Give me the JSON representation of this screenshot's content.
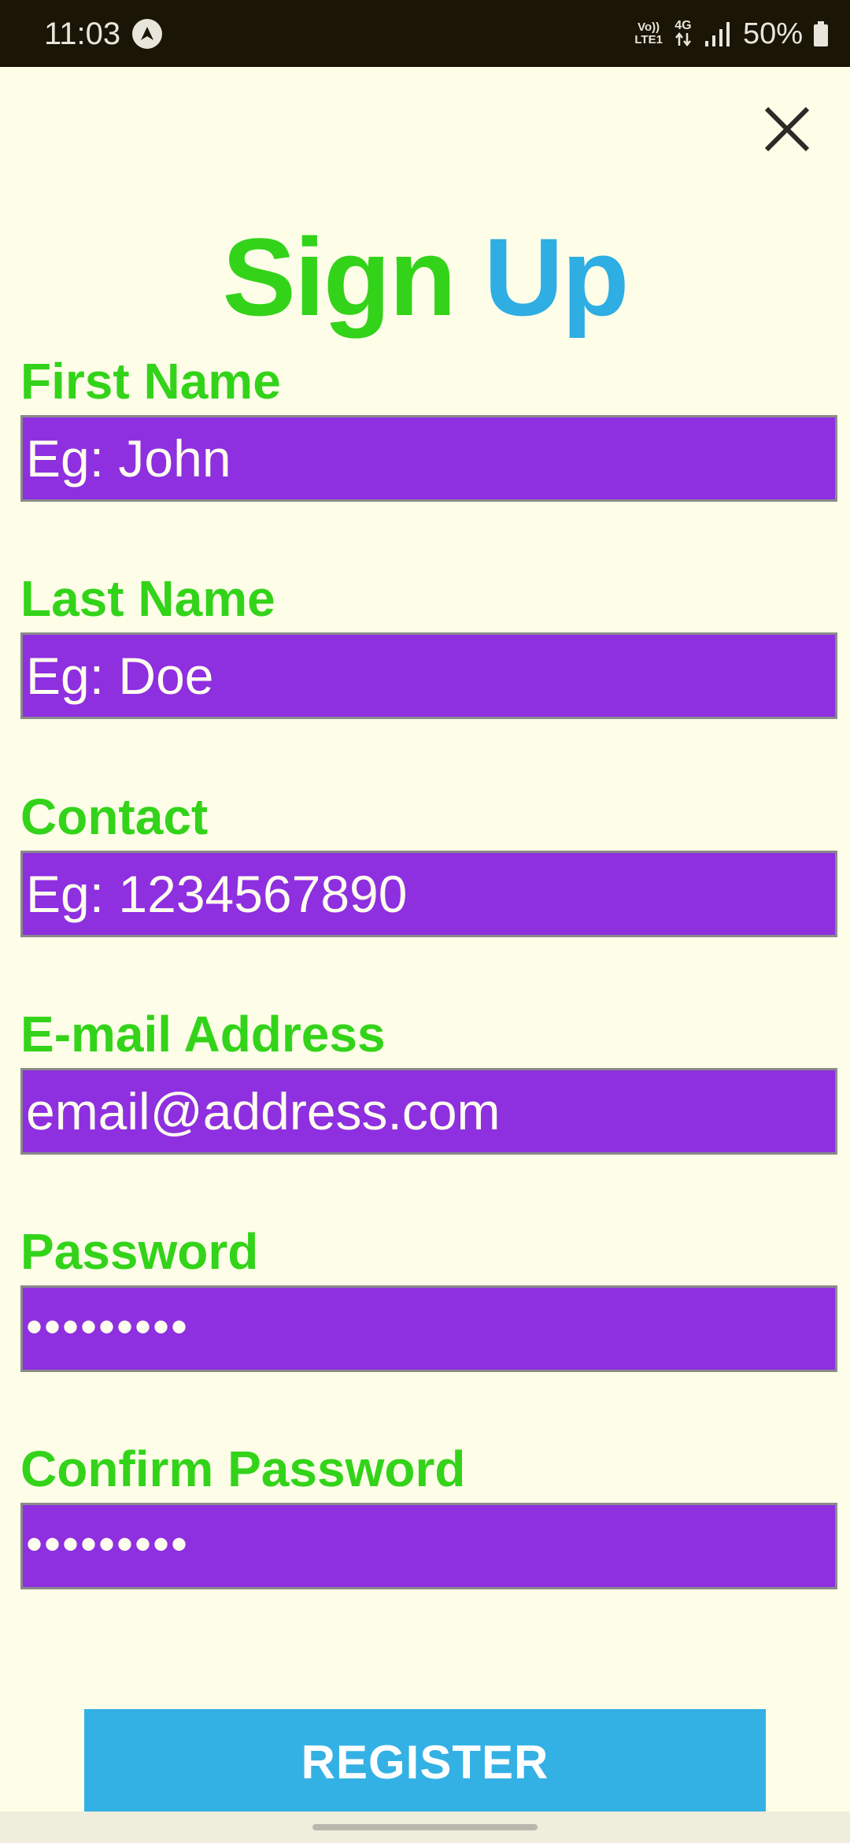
{
  "status_bar": {
    "time": "11:03",
    "volte_top": "Vo))",
    "volte_bottom": "LTE1",
    "network": "4G",
    "battery": "50%",
    "icons": [
      "navigation-icon",
      "volte-icon",
      "4g-data-icon",
      "signal-icon",
      "battery-icon"
    ]
  },
  "header": {
    "close_icon": "close-icon"
  },
  "title": {
    "part1": "Sign",
    "part2": "Up",
    "part1_color": "#33d31a",
    "part2_color": "#2eaee3"
  },
  "form": {
    "first_name": {
      "label": "First Name",
      "value": "Eg: John"
    },
    "last_name": {
      "label": "Last Name",
      "value": "Eg: Doe"
    },
    "contact": {
      "label": "Contact",
      "value": "Eg: 1234567890"
    },
    "email": {
      "label": "E-mail Address",
      "value": "email@address.com"
    },
    "password": {
      "label": "Password",
      "value": "•••••••••"
    },
    "confirm_password": {
      "label": "Confirm Password",
      "value": "•••••••••"
    }
  },
  "register_label": "REGISTER",
  "colors": {
    "background": "#fefde8",
    "label": "#33d31a",
    "input_bg": "#8e2fe0",
    "button": "#34b1e4"
  }
}
